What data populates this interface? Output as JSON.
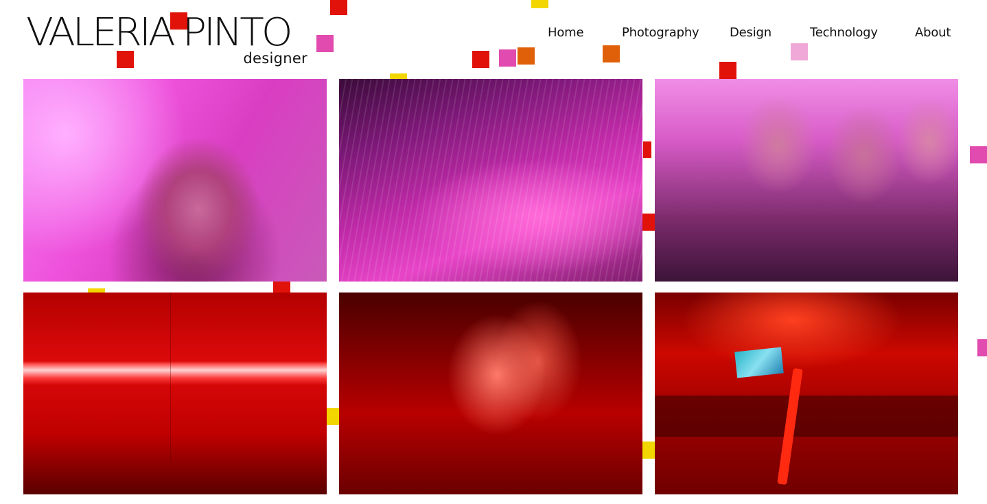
{
  "logo": {
    "name": "VALERIA PINTO",
    "subtitle": "designer"
  },
  "nav": {
    "items": [
      "Home",
      "Photography",
      "Design",
      "Technology",
      "About"
    ]
  },
  "gallery": {
    "photos": [
      {
        "subject": "portrait-pink"
      },
      {
        "subject": "chandelier-purple"
      },
      {
        "subject": "friends-laughing-pink"
      },
      {
        "subject": "neon-tube-red"
      },
      {
        "subject": "two-girls-red"
      },
      {
        "subject": "palm-tree-lounge-red"
      }
    ]
  },
  "colors": {
    "red": "#e0120a",
    "pink": "#e14aae",
    "light_pink": "#f0a8d8",
    "orange": "#e0600a",
    "yellow": "#f2d600"
  }
}
